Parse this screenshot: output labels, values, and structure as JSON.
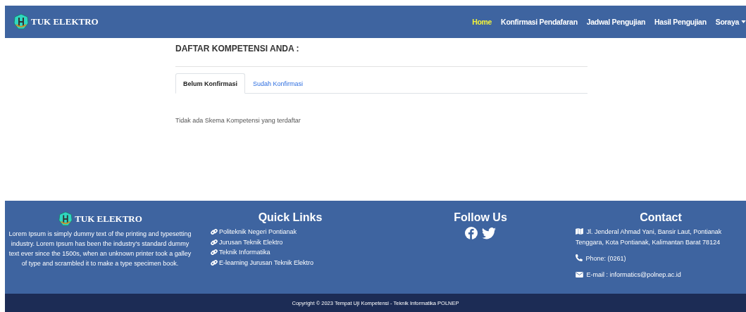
{
  "navbar": {
    "brand": "TUK ELEKTRO",
    "items": [
      {
        "label": "Home",
        "selected": true
      },
      {
        "label": "Konfirmasi Pendafaran",
        "selected": false
      },
      {
        "label": "Jadwal Pengujian",
        "selected": false
      },
      {
        "label": "Hasil Pengujian",
        "selected": false
      }
    ],
    "user": {
      "label": "Soraya"
    }
  },
  "main": {
    "heading": "DAFTAR KOMPETENSI ANDA :",
    "tabs": [
      {
        "label": "Belum Konfirmasi",
        "selected": true
      },
      {
        "label": "Sudah Konfirmasi",
        "selected": false
      }
    ],
    "empty_message": "Tidak ada Skema Kompetensi yang terdaftar"
  },
  "footer": {
    "brand": "TUK ELEKTRO",
    "about": "Lorem Ipsum is simply dummy text of the printing and typesetting industry. Lorem Ipsum has been the industry's standard dummy text ever since the 1500s, when an unknown printer took a galley of type and scrambled it to make a type specimen book.",
    "quick_links": {
      "title": "Quick Links",
      "links": [
        "Politeknik Negeri Pontianak",
        "Jurusan Teknik Elektro",
        "Teknik Informatika",
        "E-learning Jurusan Teknik Elektro"
      ]
    },
    "follow": {
      "title": "Follow Us",
      "icons": [
        {
          "kind": "facebook"
        },
        {
          "kind": "twitter"
        }
      ]
    },
    "contact": {
      "title": "Contact",
      "items": [
        {
          "kind": "address",
          "text": "Jl. Jenderal Ahmad Yani, Bansir Laut, Pontianak Tenggara, Kota Pontianak, Kalimantan Barat 78124"
        },
        {
          "kind": "phone",
          "text": "Phone: (0261)"
        },
        {
          "kind": "email",
          "text": "E-mail : informatics@polnep.ac.id"
        }
      ]
    }
  },
  "copyright": "Copyright © 2023 Tempat Uji Kompetensi - Teknik Informatika POLNEP"
}
